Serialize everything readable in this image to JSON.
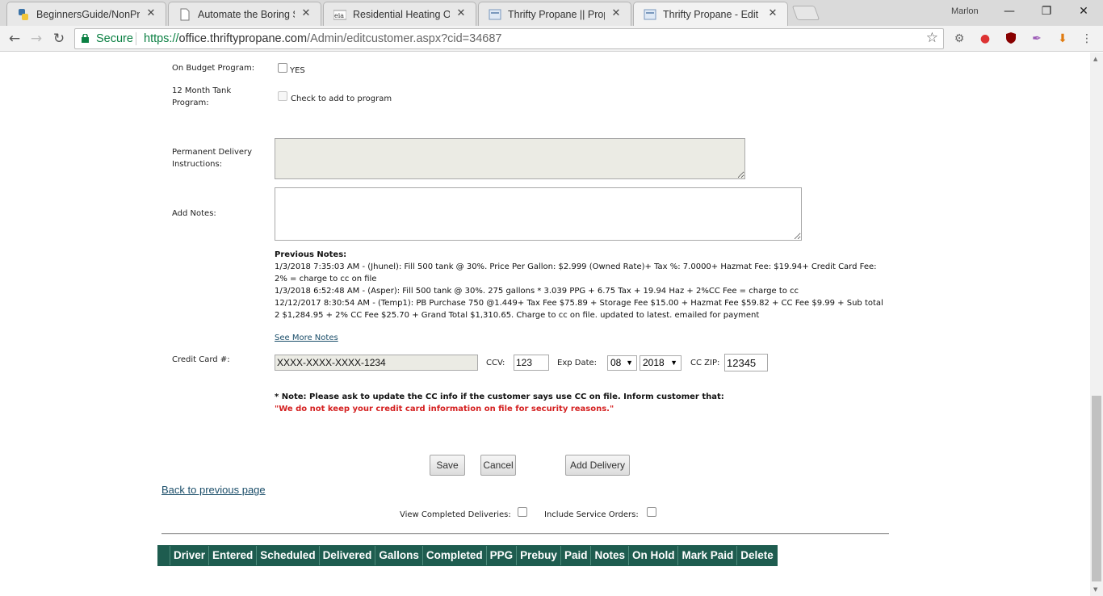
{
  "browser": {
    "tabs": [
      {
        "title": "BeginnersGuide/NonProg",
        "icon": "python-icon"
      },
      {
        "title": "Automate the Boring Stu",
        "icon": "document-icon"
      },
      {
        "title": "Residential Heating Oil W",
        "icon": "eia-icon"
      },
      {
        "title": "Thrifty Propane || Propan",
        "icon": "page-icon"
      },
      {
        "title": "Thrifty Propane - Edit Cu",
        "icon": "page-icon",
        "active": true
      }
    ],
    "close_glyph": "✕",
    "profile_name": "Marlon",
    "window": {
      "minimize": "—",
      "restore": "❐",
      "close": "✕"
    },
    "secure_label": "Secure",
    "url_scheme": "https://",
    "url_host": "office.thriftypropane.com",
    "url_path": "/Admin/editcustomer.aspx?cid=34687"
  },
  "form": {
    "budget_label": "On Budget Program:",
    "budget_option": "YES",
    "tank_label_line1": "12 Month Tank",
    "tank_label_line2": "Program:",
    "tank_option": "Check to add to program",
    "perm_label_line1": "Permanent Delivery",
    "perm_label_line2": "Instructions:",
    "add_notes_label": "Add Notes:",
    "previous_notes_heading": "Previous Notes:",
    "previous_notes": [
      "1/3/2018 7:35:03 AM - (Jhunel): Fill 500 tank @ 30%. Price Per Gallon: $2.999 (Owned Rate)+ Tax %: 7.0000+ Hazmat Fee: $19.94+ Credit Card Fee: 2% = charge to cc on file",
      "1/3/2018 6:52:48 AM - (Asper): Fill 500 tank @ 30%. 275 gallons * 3.039 PPG + 6.75 Tax + 19.94 Haz + 2%CC Fee = charge to cc",
      "12/12/2017 8:30:54 AM - (Temp1): PB Purchase 750 @1.449+ Tax Fee $75.89 + Storage Fee $15.00 + Hazmat Fee $59.82 + CC Fee $9.99 + Sub total 2 $1,284.95 + 2% CC Fee $25.70 + Grand Total $1,310.65. Charge to cc on file. updated to latest. emailed for payment"
    ],
    "see_more": "See More Notes",
    "cc_label": "Credit Card #:",
    "cc_number": "XXXX-XXXX-XXXX-1234",
    "ccv_label": "CCV:",
    "ccv_value": "123",
    "exp_label": "Exp Date:",
    "exp_month": "08",
    "exp_year": "2018",
    "zip_label": "CC ZIP:",
    "zip_value": "12345",
    "note": "* Note: Please ask to update the CC info if the customer says use CC on file. Inform customer that:",
    "warning": "\"We do not keep your credit card information on file for security reasons.\"",
    "save": "Save",
    "cancel": "Cancel",
    "add_delivery": "Add Delivery",
    "back": "Back to previous page",
    "view_completed": "View Completed Deliveries:",
    "include_service": "Include Service Orders:"
  },
  "deliveries_table": {
    "columns": [
      "",
      "Driver",
      "Entered",
      "Scheduled",
      "Delivered",
      "Gallons",
      "Completed",
      "PPG",
      "Prebuy",
      "Paid",
      "Notes",
      "On Hold",
      "Mark Paid",
      "Delete"
    ]
  },
  "colors": {
    "table_header_bg": "#1e5c4f",
    "warning_text": "#d41f1f",
    "secure_green": "#0b8043",
    "link": "#1a4d69"
  }
}
